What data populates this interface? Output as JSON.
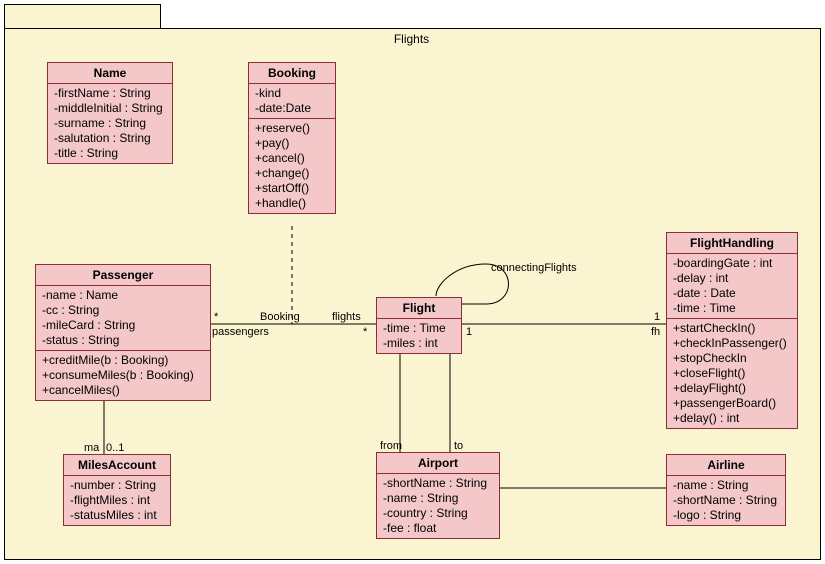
{
  "package": {
    "title": "Flights"
  },
  "classes": {
    "name": {
      "title": "Name",
      "attrs": [
        "-firstName : String",
        "-middleInitial : String",
        "-surname : String",
        "-salutation : String",
        "-title : String"
      ]
    },
    "passenger": {
      "title": "Passenger",
      "attrs": [
        "-name : Name",
        "-cc : String",
        "-mileCard : String",
        "-status : String"
      ],
      "ops": [
        "+creditMile(b : Booking)",
        "+consumeMiles(b : Booking)",
        "+cancelMiles()"
      ]
    },
    "milesaccount": {
      "title": "MilesAccount",
      "attrs": [
        "-number : String",
        "-flightMiles : int",
        "-statusMiles : int"
      ]
    },
    "booking": {
      "title": "Booking",
      "attrs": [
        "-kind",
        "-date:Date"
      ],
      "ops": [
        "+reserve()",
        "+pay()",
        "+cancel()",
        "+change()",
        "+startOff()",
        "+handle()"
      ]
    },
    "flight": {
      "title": "Flight",
      "attrs": [
        "-time : Time",
        "-miles : int"
      ]
    },
    "airport": {
      "title": "Airport",
      "attrs": [
        "-shortName : String",
        "-name : String",
        "-country : String",
        "-fee : float"
      ]
    },
    "flighthandling": {
      "title": "FlightHandling",
      "attrs": [
        "-boardingGate : int",
        "-delay : int",
        "-date : Date",
        "-time : Time"
      ],
      "ops": [
        "+startCheckIn()",
        "+checkInPassenger()",
        "+stopCheckIn",
        "+closeFlight()",
        "+delayFlight()",
        "+passengerBoard()",
        "+delay() : int"
      ]
    },
    "airline": {
      "title": "Airline",
      "attrs": [
        "-name : String",
        "-shortName : String",
        "-logo : String"
      ]
    }
  },
  "labels": {
    "passengers": "passengers",
    "passengers_mult": "*",
    "booking_role": "Booking",
    "flights_role": "flights",
    "flights_mult": "*",
    "from": "from",
    "to": "to",
    "ma": "ma",
    "ma_mult": "0..1",
    "connecting": "connectingFlights",
    "fh_left": "1",
    "fh_right": "1",
    "fh": "fh"
  },
  "chart_data": {
    "type": "uml-class-diagram",
    "package": "Flights",
    "classes": [
      {
        "name": "Name",
        "attrs": [
          "firstName:String",
          "middleInitial:String",
          "surname:String",
          "salutation:String",
          "title:String"
        ],
        "ops": []
      },
      {
        "name": "Passenger",
        "attrs": [
          "name:Name",
          "cc:String",
          "mileCard:String",
          "status:String"
        ],
        "ops": [
          "creditMile(b:Booking)",
          "consumeMiles(b:Booking)",
          "cancelMiles()"
        ]
      },
      {
        "name": "MilesAccount",
        "attrs": [
          "number:String",
          "flightMiles:int",
          "statusMiles:int"
        ],
        "ops": []
      },
      {
        "name": "Booking",
        "attrs": [
          "kind",
          "date:Date"
        ],
        "ops": [
          "reserve()",
          "pay()",
          "cancel()",
          "change()",
          "startOff()",
          "handle()"
        ]
      },
      {
        "name": "Flight",
        "attrs": [
          "time:Time",
          "miles:int"
        ],
        "ops": []
      },
      {
        "name": "Airport",
        "attrs": [
          "shortName:String",
          "name:String",
          "country:String",
          "fee:float"
        ],
        "ops": []
      },
      {
        "name": "FlightHandling",
        "attrs": [
          "boardingGate:int",
          "delay:int",
          "date:Date",
          "time:Time"
        ],
        "ops": [
          "startCheckIn()",
          "checkInPassenger()",
          "stopCheckIn",
          "closeFlight()",
          "delayFlight()",
          "passengerBoard()",
          "delay():int"
        ]
      },
      {
        "name": "Airline",
        "attrs": [
          "name:String",
          "shortName:String",
          "logo:String"
        ],
        "ops": []
      }
    ],
    "associations": [
      {
        "from": "Passenger",
        "to": "Flight",
        "end1": {
          "role": "passengers",
          "mult": "*"
        },
        "end2": {
          "role": "flights",
          "mult": "*"
        },
        "assocClass": "Booking"
      },
      {
        "from": "Passenger",
        "to": "MilesAccount",
        "end2": {
          "role": "ma",
          "mult": "0..1"
        }
      },
      {
        "from": "Flight",
        "to": "FlightHandling",
        "end1": {
          "mult": "1"
        },
        "end2": {
          "role": "fh",
          "mult": "1"
        }
      },
      {
        "from": "Flight",
        "to": "Airport",
        "end2": {
          "role": "from"
        }
      },
      {
        "from": "Flight",
        "to": "Airport",
        "end2": {
          "role": "to"
        }
      },
      {
        "from": "Flight",
        "to": "Flight",
        "self": true,
        "role": "connectingFlights"
      },
      {
        "from": "Airport",
        "to": "Airline"
      }
    ]
  }
}
